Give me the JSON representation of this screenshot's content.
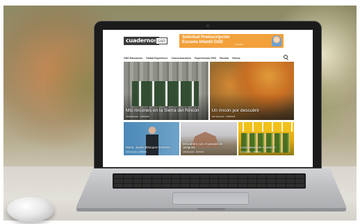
{
  "site": {
    "logo": "cuadernos",
    "logo_tag": "GSD",
    "banner": {
      "line1": "Solicitud Preinscripción",
      "line2": "Escuela Infantil GSD",
      "note": "0-3 años"
    },
    "nav": [
      "GSD Educación",
      "Global Experience",
      "Comunicaciones",
      "Experiencias GSD",
      "Revista",
      "Vídeos"
    ],
    "hero": [
      {
        "title": "Mis rincones en la Sierra del Rincón",
        "meta": "GSD Educación · 24/05/2019"
      },
      {
        "title": "Un rincón por descubrir",
        "meta": "GSD Educación · 24/05/2019"
      }
    ],
    "cards": [
      {
        "title": "Mons. Javier Blázquez Ferreiro",
        "meta": "GSD Educación · 24/05/2019"
      },
      {
        "title": "Encuentro con el pasado de antiguos",
        "meta": "GSD Educación · 24/05/2019"
      },
      {
        "title": "Conociendo en Camerún",
        "meta": "GSD Educación · 24/05/2019"
      }
    ]
  },
  "colors": {
    "banner": "#f2a13b",
    "logo": "#3b3b3b",
    "laptop_bezel": "#1b1b1b"
  }
}
